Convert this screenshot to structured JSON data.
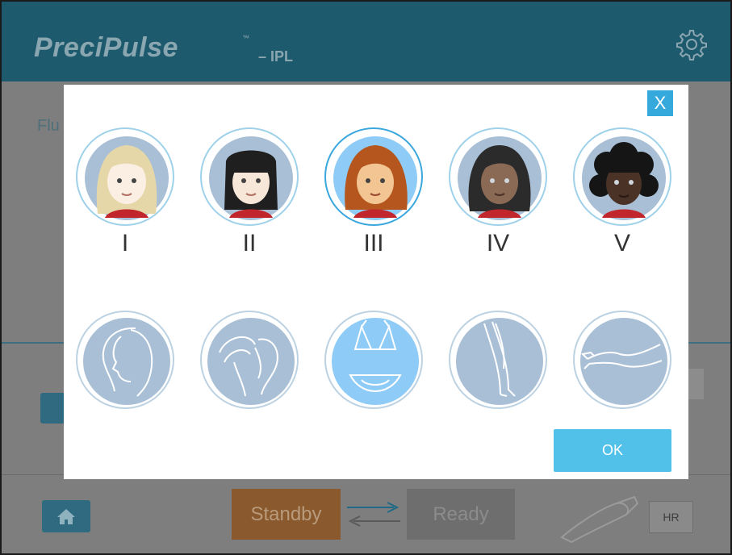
{
  "header": {
    "brand": "PreciPulse",
    "brand_tm": "™",
    "brand_suffix": "– IPL",
    "settings_icon": "gear-icon"
  },
  "background": {
    "label_partial": "Flu",
    "footer": {
      "home_icon": "home-icon",
      "standby_label": "Standby",
      "ready_label": "Ready",
      "handpiece_badge": "HR"
    }
  },
  "modal": {
    "close_label": "X",
    "skin_types": [
      {
        "label": "I",
        "hair": "#e6d7a8",
        "skin": "#fbeee2",
        "selected": false
      },
      {
        "label": "II",
        "hair": "#1f1f1f",
        "skin": "#f6e7d8",
        "selected": false
      },
      {
        "label": "III",
        "hair": "#b5561e",
        "skin": "#f2c592",
        "selected": true
      },
      {
        "label": "IV",
        "hair": "#2b2b2b",
        "skin": "#8a6a55",
        "selected": false
      },
      {
        "label": "V",
        "hair": "#151515",
        "skin": "#4a3326",
        "selected": false
      }
    ],
    "treatment_areas": [
      {
        "icon": "face-icon",
        "selected": false
      },
      {
        "icon": "underarm-icon",
        "selected": false
      },
      {
        "icon": "bikini-icon",
        "selected": true
      },
      {
        "icon": "legs-icon",
        "selected": false
      },
      {
        "icon": "arm-icon",
        "selected": false
      }
    ],
    "ok_label": "OK"
  },
  "colors": {
    "accent": "#35a9dc",
    "ok_button": "#52c1ea",
    "selected_area": "#8ecbf7",
    "unselected_area": "#a9bfd6",
    "header_bg": "#1e5a6d"
  }
}
